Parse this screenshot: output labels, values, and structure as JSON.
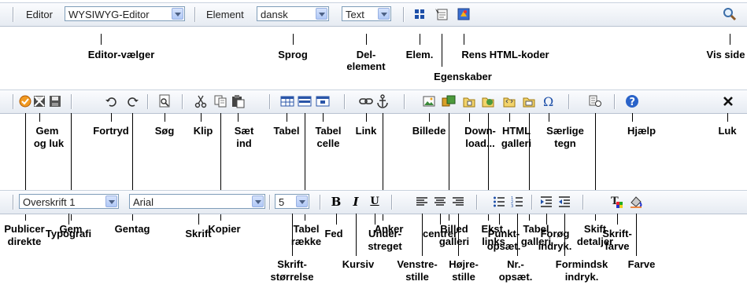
{
  "toolbar1": {
    "editor_label": "Editor",
    "editor_select": "WYSIWYG-Editor",
    "element_label": "Element",
    "element_select": "dansk",
    "text_select": "Text"
  },
  "labels1": {
    "editor_selector": "Editor-vælger",
    "language": "Sprog",
    "sub_element_1": "Del-",
    "sub_element_2": "element",
    "elem": "Elem.",
    "properties": "Egenskaber",
    "clean_html": "Rens HTML-koder",
    "show_page": "Vis side"
  },
  "labels2": {
    "publish_1": "Publicer",
    "publish_2": "direkte",
    "save_close_1": "Gem",
    "save_close_2": "og luk",
    "save": "Gem",
    "undo": "Fortryd",
    "redo": "Gentag",
    "search": "Søg",
    "cut": "Klip",
    "copy": "Kopier",
    "paste_1": "Sæt",
    "paste_2": "ind",
    "table": "Tabel",
    "table_row_1": "Tabel",
    "table_row_2": "række",
    "table_cell_1": "Tabel",
    "table_cell_2": "celle",
    "link": "Link",
    "anchor": "Anker",
    "image": "Billede",
    "image_gallery_1": "Billed",
    "image_gallery_2": "galleri",
    "download_1": "Down-",
    "download_2": "load...",
    "ext_links_1": "Ekst.",
    "ext_links_2": "links",
    "html_gallery_1": "HTML",
    "html_gallery_2": "galleri",
    "table_gallery_1": "Tabel",
    "table_gallery_2": "galleri",
    "special_chars_1": "Særlige",
    "special_chars_2": "tegn",
    "switch_details_1": "Skift",
    "switch_details_2": "detaljer",
    "help": "Hjælp",
    "close": "Luk"
  },
  "toolbar3": {
    "format_select": "Overskrift 1",
    "font_select": "Arial",
    "size_select": "5",
    "bold": "B",
    "italic": "I",
    "underline": "U"
  },
  "labels3": {
    "typography": "Typografi",
    "font": "Skrift",
    "font_size_1": "Skrift-",
    "font_size_2": "størrelse",
    "bold": "Fed",
    "italic": "Kursiv",
    "underline_1": "Under-",
    "underline_2": "streget",
    "align_left_1": "Venstre-",
    "align_left_2": "stille",
    "center": "centrer",
    "align_right_1": "Højre-",
    "align_right_2": "stille",
    "bullets_1": "Punkt-",
    "bullets_2": "opsæt.",
    "numbering_1": "Nr.-",
    "numbering_2": "opsæt.",
    "indent_1": "Forøg",
    "indent_2": "indryk.",
    "outdent_1": "Formindsk",
    "outdent_2": "indryk.",
    "font_color_1": "Skrift-",
    "font_color_2": "farve",
    "color": "Farve"
  }
}
